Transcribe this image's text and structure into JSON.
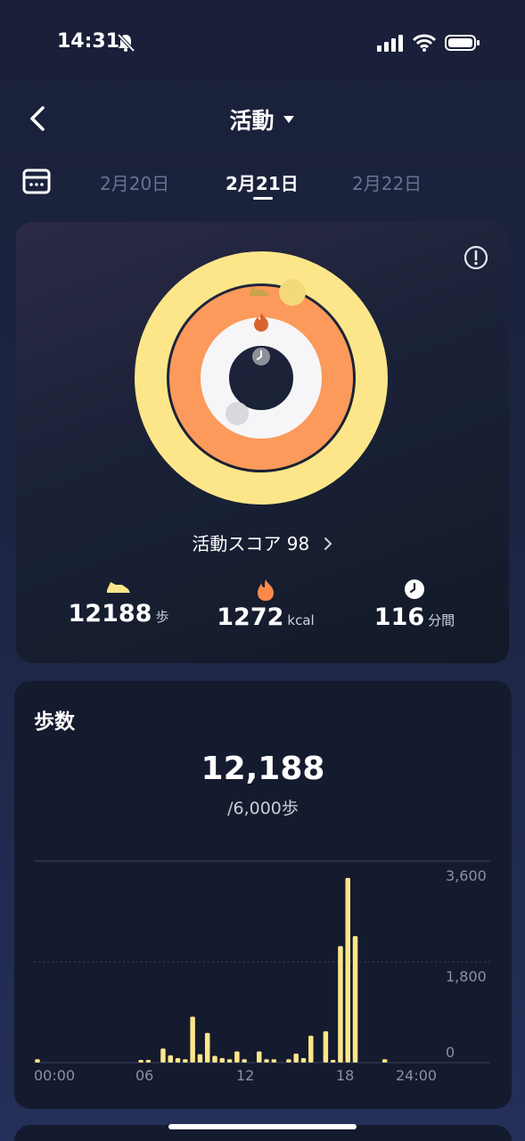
{
  "status_bar": {
    "time": "14:31"
  },
  "header": {
    "title": "活動"
  },
  "dates": {
    "prev": "2月20日",
    "current": "2月21日",
    "next": "2月22日"
  },
  "activity": {
    "score_label": "活動スコア 98",
    "score": 98,
    "steps_value": "12188",
    "steps_unit": "歩",
    "calories_value": "1272",
    "calories_unit": "kcal",
    "minutes_value": "116",
    "minutes_unit": "分間",
    "colors": {
      "steps": "#fde68a",
      "calories": "#fb9a5a",
      "minutes": "#ffffff"
    }
  },
  "steps_card": {
    "title": "歩数",
    "total": "12,188",
    "goal": "/6,000歩"
  },
  "chart_data": {
    "type": "bar",
    "y_ticks": [
      "3,600",
      "1,800",
      "0"
    ],
    "ylim": [
      0,
      3600
    ],
    "x_ticks": [
      "00:00",
      "06",
      "12",
      "18",
      "24:00"
    ],
    "x_range": [
      0,
      48
    ],
    "values": [
      60,
      0,
      0,
      0,
      0,
      0,
      0,
      0,
      0,
      0,
      0,
      0,
      0,
      0,
      0,
      0,
      0,
      0,
      0,
      0,
      0,
      0,
      0,
      0,
      0,
      0,
      0,
      0,
      0,
      0,
      0,
      0,
      0,
      0,
      0,
      0,
      0,
      0,
      0,
      0,
      0,
      0,
      0,
      0,
      0,
      0,
      0,
      0
    ],
    "bars": [
      {
        "x": 0,
        "v": 60
      },
      {
        "x": 14,
        "v": 40
      },
      {
        "x": 15,
        "v": 40
      },
      {
        "x": 17,
        "v": 250
      },
      {
        "x": 18,
        "v": 130
      },
      {
        "x": 19,
        "v": 80
      },
      {
        "x": 20,
        "v": 60
      },
      {
        "x": 21,
        "v": 820
      },
      {
        "x": 22,
        "v": 150
      },
      {
        "x": 23,
        "v": 530
      },
      {
        "x": 24,
        "v": 120
      },
      {
        "x": 25,
        "v": 80
      },
      {
        "x": 26,
        "v": 60
      },
      {
        "x": 27,
        "v": 200
      },
      {
        "x": 28,
        "v": 60
      },
      {
        "x": 30,
        "v": 200
      },
      {
        "x": 31,
        "v": 60
      },
      {
        "x": 32,
        "v": 60
      },
      {
        "x": 34,
        "v": 60
      },
      {
        "x": 35,
        "v": 160
      },
      {
        "x": 36,
        "v": 80
      },
      {
        "x": 37,
        "v": 480
      },
      {
        "x": 39,
        "v": 560
      },
      {
        "x": 40,
        "v": 40
      },
      {
        "x": 41,
        "v": 2080
      },
      {
        "x": 42,
        "v": 3300
      },
      {
        "x": 43,
        "v": 2260
      },
      {
        "x": 47,
        "v": 60
      }
    ],
    "bar_color": "#fde68a",
    "grid": true
  }
}
